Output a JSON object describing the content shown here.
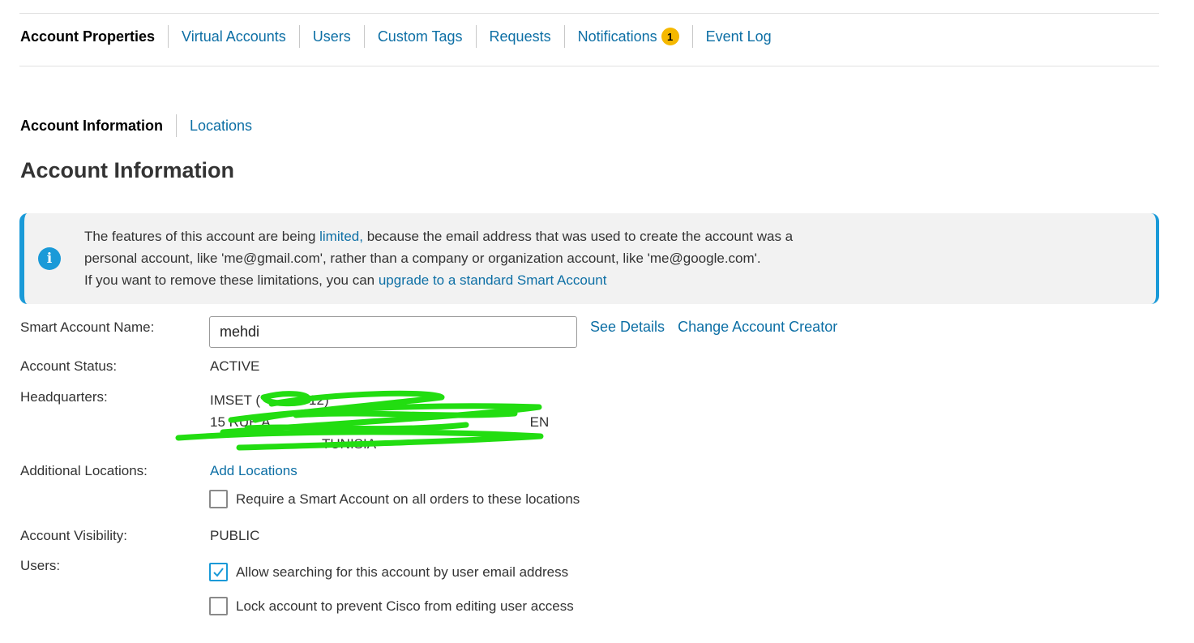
{
  "top_tabs": [
    {
      "label": "Account Properties",
      "active": true
    },
    {
      "label": "Virtual Accounts"
    },
    {
      "label": "Users"
    },
    {
      "label": "Custom Tags"
    },
    {
      "label": "Requests"
    },
    {
      "label": "Notifications",
      "badge": "1"
    },
    {
      "label": "Event Log"
    }
  ],
  "sub_tabs": [
    {
      "label": "Account Information",
      "active": true
    },
    {
      "label": "Locations"
    }
  ],
  "page_title": "Account Information",
  "alert": {
    "icon": "info-icon",
    "line1_a": "The features of this account are being ",
    "line1_link": "limited,",
    "line1_b": " because the email address that was used to create the account was a",
    "line2": "personal account, like 'me@gmail.com', rather than a company or organization account, like 'me@google.com'.",
    "line3_a": "If you want to remove these limitations, you can ",
    "line3_link": "upgrade to a standard Smart Account"
  },
  "fields": {
    "smart_account_name": {
      "label": "Smart Account Name:",
      "value": "mehdi",
      "see_details": "See Details",
      "change_creator": "Change Account Creator"
    },
    "account_status": {
      "label": "Account Status:",
      "value": "ACTIVE"
    },
    "headquarters": {
      "label": "Headquarters:",
      "line1": "IMSET (",
      "line1_end": "12)",
      "line2": "15 RUE A",
      "line2_end": "EN",
      "line3_end": "TUNISIA"
    },
    "additional_locations": {
      "label": "Additional Locations:",
      "add_link": "Add Locations",
      "require_checkbox": {
        "label": "Require a Smart Account on all orders to these locations",
        "checked": false
      }
    },
    "account_visibility": {
      "label": "Account Visibility:",
      "value": "PUBLIC"
    },
    "users": {
      "label": "Users:",
      "allow_search": {
        "label": "Allow searching for this account by user email address",
        "checked": true
      },
      "lock_account": {
        "label": "Lock account to prevent Cisco from editing user access",
        "checked": false
      }
    }
  },
  "colors": {
    "link": "#0d6fa5",
    "accent": "#1a9ad8",
    "badge": "#f5b800",
    "redaction": "#22dd11"
  }
}
